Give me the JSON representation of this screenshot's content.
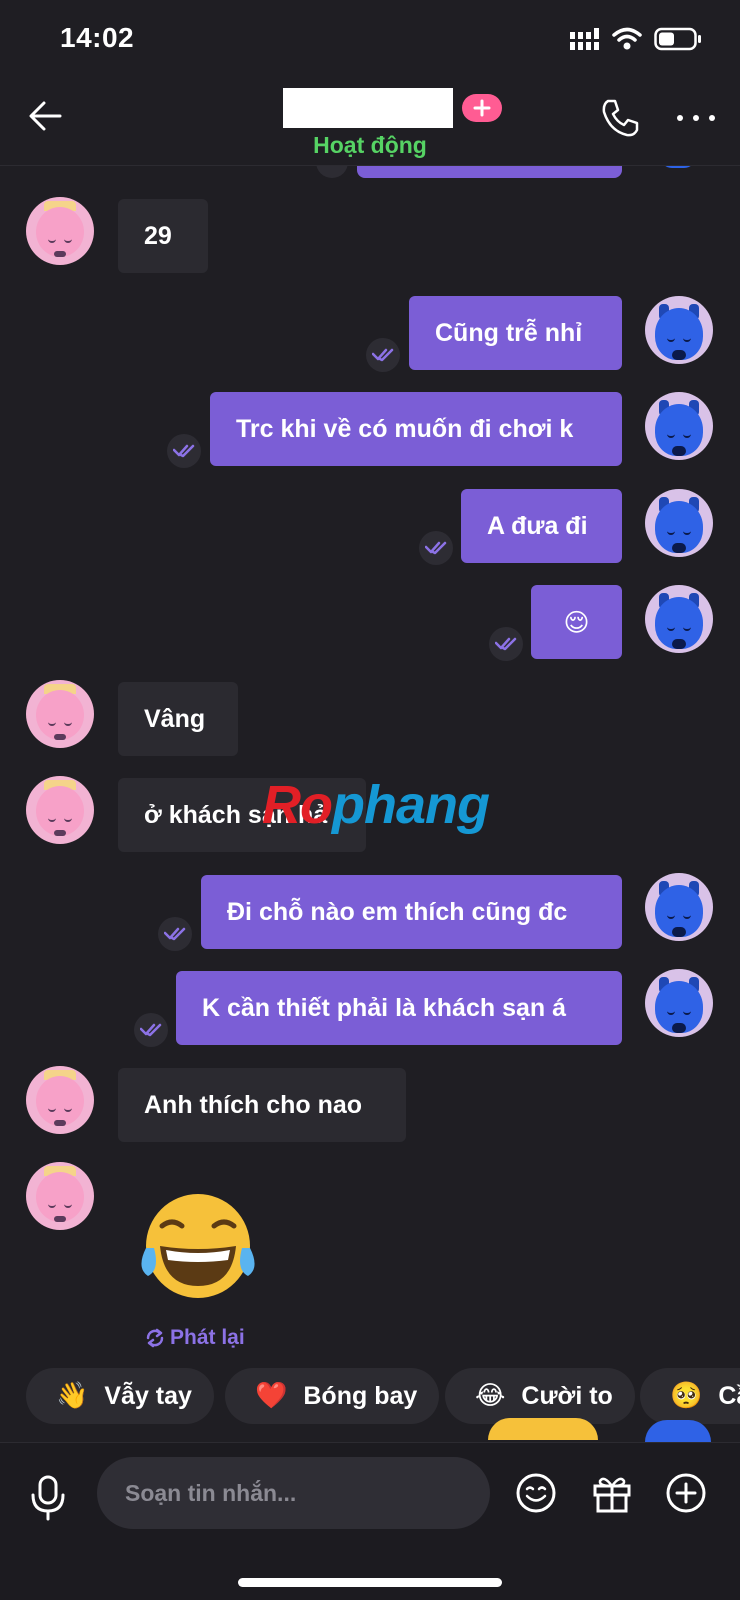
{
  "status_bar": {
    "time": "14:02"
  },
  "header": {
    "status": "Hoạt động",
    "add_label": "+"
  },
  "messages": [
    {
      "side": "in",
      "text": "29"
    },
    {
      "side": "out",
      "text": "Cũng trễ nhỉ"
    },
    {
      "side": "out",
      "text": "Trc khi về có muốn đi chơi k"
    },
    {
      "side": "out",
      "text": "A đưa đi"
    },
    {
      "side": "out",
      "text": "😌"
    },
    {
      "side": "in",
      "text": "Vâng"
    },
    {
      "side": "in",
      "text": "ở khách sạn hả"
    },
    {
      "side": "out",
      "text": "Đi chỗ nào em thích cũng đc"
    },
    {
      "side": "out",
      "text": "K cần thiết phải là khách sạn á"
    },
    {
      "side": "in",
      "text": "Anh thích cho nao"
    }
  ],
  "big_emoji": {
    "icon": "laughing-tears-emoji",
    "replay_label": "Phát lại"
  },
  "quick_reactions": [
    {
      "emoji": "👋",
      "label": "Vẫy tay"
    },
    {
      "emoji": "❤️",
      "label": "Bóng bay"
    },
    {
      "emoji": "😂",
      "label": "Cười to"
    },
    {
      "emoji": "🥺",
      "label": "Cầ"
    }
  ],
  "composer": {
    "placeholder": "Soạn tin nhắn..."
  },
  "watermark": {
    "part_a": "Ro",
    "part_b": "phang"
  },
  "colors": {
    "background": "#1f1e23",
    "outgoing_bubble": "#7b5ed6",
    "incoming_bubble": "#2b2a30",
    "online_status": "#56d364",
    "accent_pink": "#ff5c93"
  }
}
